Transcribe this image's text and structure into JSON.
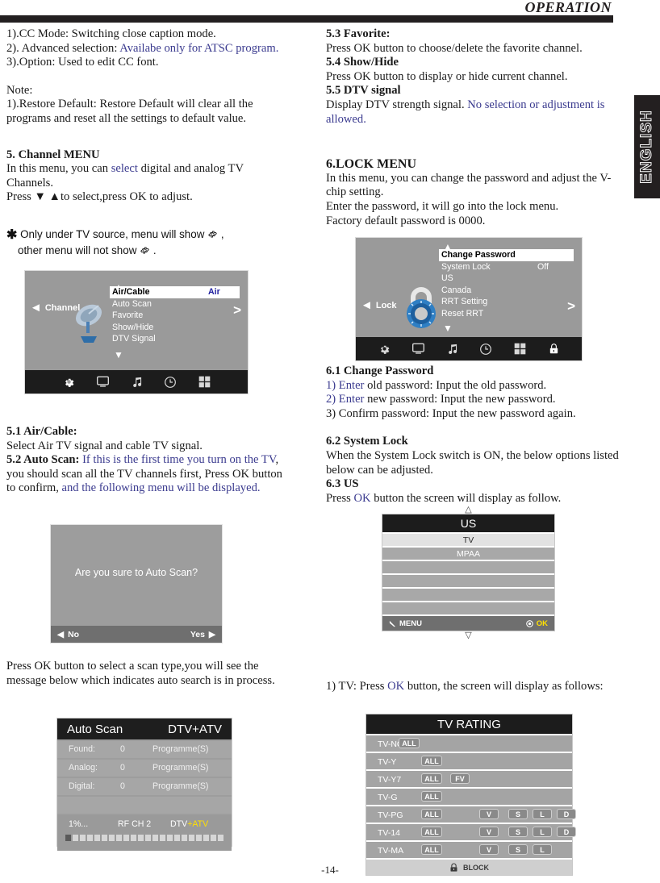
{
  "header": {
    "title": "OPERATION",
    "language_tab": "ENGLISH"
  },
  "page_number": "-14-",
  "left_column": {
    "cc_lines": [
      "1).CC Mode: Switching close caption mode.",
      "2). Advanced selection: ",
      "Availabe only for ATSC program.",
      "3).Option: Used to edit CC font."
    ],
    "note_label": "Note:",
    "note_text": "1).Restore Default: Restore Default will clear all the programs and reset all the settings to default value.",
    "channel_menu": {
      "heading": "5. Channel MENU",
      "line1_a": "In this menu, you can ",
      "line1_blue": "select",
      "line1_b": " digital and analog TV Channels.",
      "line2": "Press ▼ ▲to select,press OK to adjust."
    },
    "asterisk_note": {
      "star": "✱",
      "line1_a": "Only under TV source, menu will show ",
      "line1_b": " ,",
      "line2_a": "other menu will not show ",
      "line2_b": " ."
    },
    "sections": {
      "s51_head": "5.1 Air/Cable:",
      "s51_text": "Select Air TV signal and cable TV signal.",
      "s52_head": "5.2 Auto Scan: ",
      "s52_blue1": "If this is the first time you turn on the TV",
      "s52_black1": ", you should scan all the TV channels first,",
      "s52_black2": "Press OK button to confirm, ",
      "s52_blue2": "and the following menu will be displayed."
    },
    "scan_hint": "Press OK button to select a scan type,you will see the message below which indicates auto search is in process."
  },
  "channel_osd": {
    "side_label": "Channel",
    "left_arrow": "◄",
    "right_arrow": ">",
    "up_arrow": "▲",
    "down_arrow": "▼",
    "rows": [
      {
        "label": "Air/Cable",
        "value": "Air",
        "selected": true
      },
      {
        "label": "Auto Scan",
        "value": "",
        "selected": false
      },
      {
        "label": "Favorite",
        "value": "",
        "selected": false
      },
      {
        "label": "Show/Hide",
        "value": "",
        "selected": false
      },
      {
        "label": "DTV Signal",
        "value": "",
        "selected": false
      }
    ],
    "icons": [
      "gear-icon",
      "tv-icon",
      "music-icon",
      "clock-icon",
      "grid-icon"
    ]
  },
  "confirm_dialog": {
    "message": "Are you sure to Auto Scan?",
    "no_label": "No",
    "yes_label": "Yes",
    "left_arrow": "◀",
    "right_arrow": "▶"
  },
  "auto_scan": {
    "title": "Auto Scan",
    "mode": "DTV+ATV",
    "rows": [
      {
        "key": "Found:",
        "count": "0",
        "unit": "Programme(S)"
      },
      {
        "key": "Analog:",
        "count": "0",
        "unit": "Programme(S)"
      },
      {
        "key": "Digital:",
        "count": "0",
        "unit": "Programme(S)"
      }
    ],
    "percent": "1%...",
    "rf": "RF CH 2",
    "dtv_prefix": "DTV",
    "atv_suffix": "+ATV",
    "progress_filled": 1,
    "progress_total": 22
  },
  "right_column": {
    "s53_head": "5.3 Favorite:",
    "s53_text": "Press OK button to choose/delete the favorite channel.",
    "s54_head": "5.4 Show/Hide",
    "s54_text": "Press OK button to display or hide current channel.",
    "s55_head": "5.5 DTV signal",
    "s55_text_a": "Display DTV strength signal. ",
    "s55_text_blue": "No selection or adjustment is allowed.",
    "lock_menu": {
      "heading": "6.LOCK MENU",
      "line1": "In this menu, you can change the password and adjust the V-chip setting.",
      "line2": "Enter the password, it will go into the lock menu.",
      "line3": "Factory default password is 0000."
    },
    "s61_head": "6.1 Change Password",
    "s61_1_blue": "1) Enter",
    "s61_1_rest": " old password: Input the old password.",
    "s61_2_blue": "2) Enter",
    "s61_2_rest": " new password: Input the new password.",
    "s61_3": "3) Confirm password: Input the new password again.",
    "s62_head": "6.2 System Lock",
    "s62_text": "When the System Lock switch is ON, the below options listed below can be adjusted.",
    "s63_head": "6.3 US",
    "s63_a": "Press ",
    "s63_blue": "OK",
    "s63_b": " button the screen will display as follow.",
    "tv_note_a": "1) TV: Press ",
    "tv_note_blue": "OK",
    "tv_note_b": " button, the screen will display as follows:"
  },
  "lock_osd": {
    "side_label": "Lock",
    "left_arrow": "◄",
    "right_arrow": ">",
    "up_arrow": "▲",
    "down_arrow": "▼",
    "rows": [
      {
        "label": "Change Password",
        "value": "",
        "selected": true
      },
      {
        "label": "System Lock",
        "value": "Off",
        "selected": false
      },
      {
        "label": "US",
        "value": "",
        "selected": false
      },
      {
        "label": "Canada",
        "value": "",
        "selected": false
      },
      {
        "label": "RRT Setting",
        "value": "",
        "selected": false
      },
      {
        "label": "Reset RRT",
        "value": "",
        "selected": false
      }
    ],
    "icons": [
      "gear-icon",
      "tv-icon",
      "music-icon",
      "clock-icon",
      "grid-icon",
      "lock-icon"
    ]
  },
  "us_list": {
    "up_tri": "△",
    "down_tri": "▽",
    "title": "US",
    "items": [
      "TV",
      "MPAA",
      "",
      "",
      "",
      ""
    ],
    "selected_index": 0,
    "menu_label": "MENU",
    "ok_label": "OK"
  },
  "tv_rating": {
    "title": "TV RATING",
    "rows": [
      {
        "name": "TV-NONE",
        "chips": [
          "ALL"
        ],
        "cols": [
          0
        ]
      },
      {
        "name": "TV-Y",
        "chips": [
          "ALL"
        ],
        "cols": [
          1
        ]
      },
      {
        "name": "TV-Y7",
        "chips": [
          "ALL",
          "FV"
        ],
        "cols": [
          1,
          2
        ]
      },
      {
        "name": "TV-G",
        "chips": [
          "ALL"
        ],
        "cols": [
          1
        ]
      },
      {
        "name": "TV-PG",
        "chips": [
          "ALL",
          "V",
          "S",
          "L",
          "D"
        ],
        "cols": [
          1,
          3,
          4,
          5,
          6
        ]
      },
      {
        "name": "TV-14",
        "chips": [
          "ALL",
          "V",
          "S",
          "L",
          "D"
        ],
        "cols": [
          1,
          3,
          4,
          5,
          6
        ]
      },
      {
        "name": "TV-MA",
        "chips": [
          "ALL",
          "V",
          "S",
          "L"
        ],
        "cols": [
          1,
          3,
          4,
          5
        ]
      }
    ],
    "footer": "BLOCK"
  },
  "colors": {
    "blue_text": "#3b3b8f",
    "osd_bg": "#9a9a9a",
    "osd_bar": "#1c1c1c",
    "accent_yellow": "#ffe000"
  }
}
